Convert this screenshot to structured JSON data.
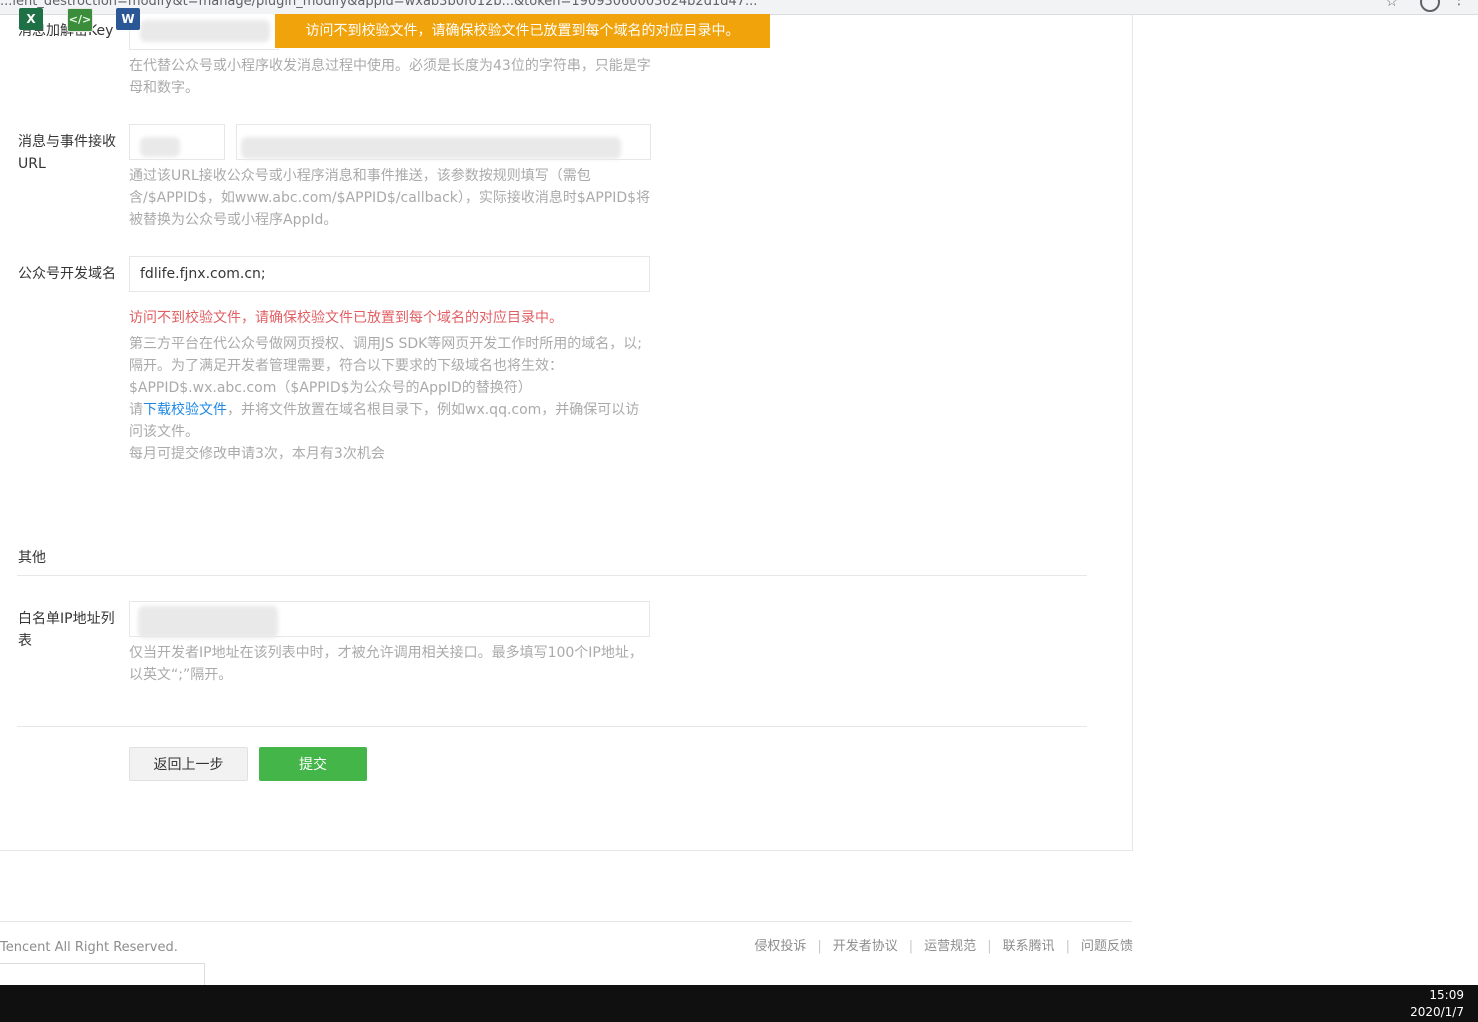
{
  "browser": {
    "url": "...ient_destroction=modify&t=manage/plugin_modify&appid=wxab3b0f012b...&token=19093060003624b2d1d47...",
    "star_icon": "star-icon",
    "account_icon": "account-icon",
    "menu_icon": "more-vert-icon"
  },
  "toast": {
    "text": "访问不到校验文件，请确保校验文件已放置到每个域名的对应目录中。",
    "color": "#f0a30a"
  },
  "fields": {
    "key": {
      "label": "消息加解密Key",
      "help": "在代替公众号或小程序收发消息过程中使用。必须是长度为43位的字符串，只能是字母和数字。"
    },
    "url": {
      "label": "消息与事件接收URL",
      "help": "通过该URL接收公众号或小程序消息和事件推送，该参数按规则填写（需包含/$APPID$，如www.abc.com/$APPID$/callback），实际接收消息时$APPID$将被替换为公众号或小程序AppId。"
    },
    "domain": {
      "label": "公众号开发域名",
      "value": "fdlife.fjnx.com.cn;",
      "error": "访问不到校验文件，请确保校验文件已放置到每个域名的对应目录中。",
      "help1": "第三方平台在代公众号做网页授权、调用JS SDK等网页开发工作时所用的域名，以;隔开。为了满足开发者管理需要，符合以下要求的下级域名也将生效：$APPID$.wx.abc.com（$APPID$为公众号的AppID的替换符）",
      "help2_prefix": "请",
      "help2_link": "下载校验文件",
      "help2_suffix": "，并将文件放置在域名根目录下，例如wx.qq.com，并确保可以访问该文件。",
      "help3": "每月可提交修改申请3次，本月有3次机会"
    },
    "ip": {
      "label": "白名单IP地址列表",
      "help": "仅当开发者IP地址在该列表中时，才被允许调用相关接口。最多填写100个IP地址，以英文“;”隔开。"
    }
  },
  "section_other": "其他",
  "buttons": {
    "back": "返回上一步",
    "submit": "提交",
    "submit_color": "#44b549"
  },
  "footer": {
    "copyright": "Tencent All Right Reserved.",
    "links": [
      "侵权投诉",
      "开发者协议",
      "运营规范",
      "联系腾讯",
      "问题反馈"
    ]
  },
  "taskbar": {
    "apps": [
      {
        "name": "excel-icon",
        "glyph": "X"
      },
      {
        "name": "code-editor-icon",
        "glyph": "</>"
      },
      {
        "name": "word-icon",
        "glyph": "W"
      }
    ],
    "time": "15:09",
    "date": "2020/1/7"
  }
}
